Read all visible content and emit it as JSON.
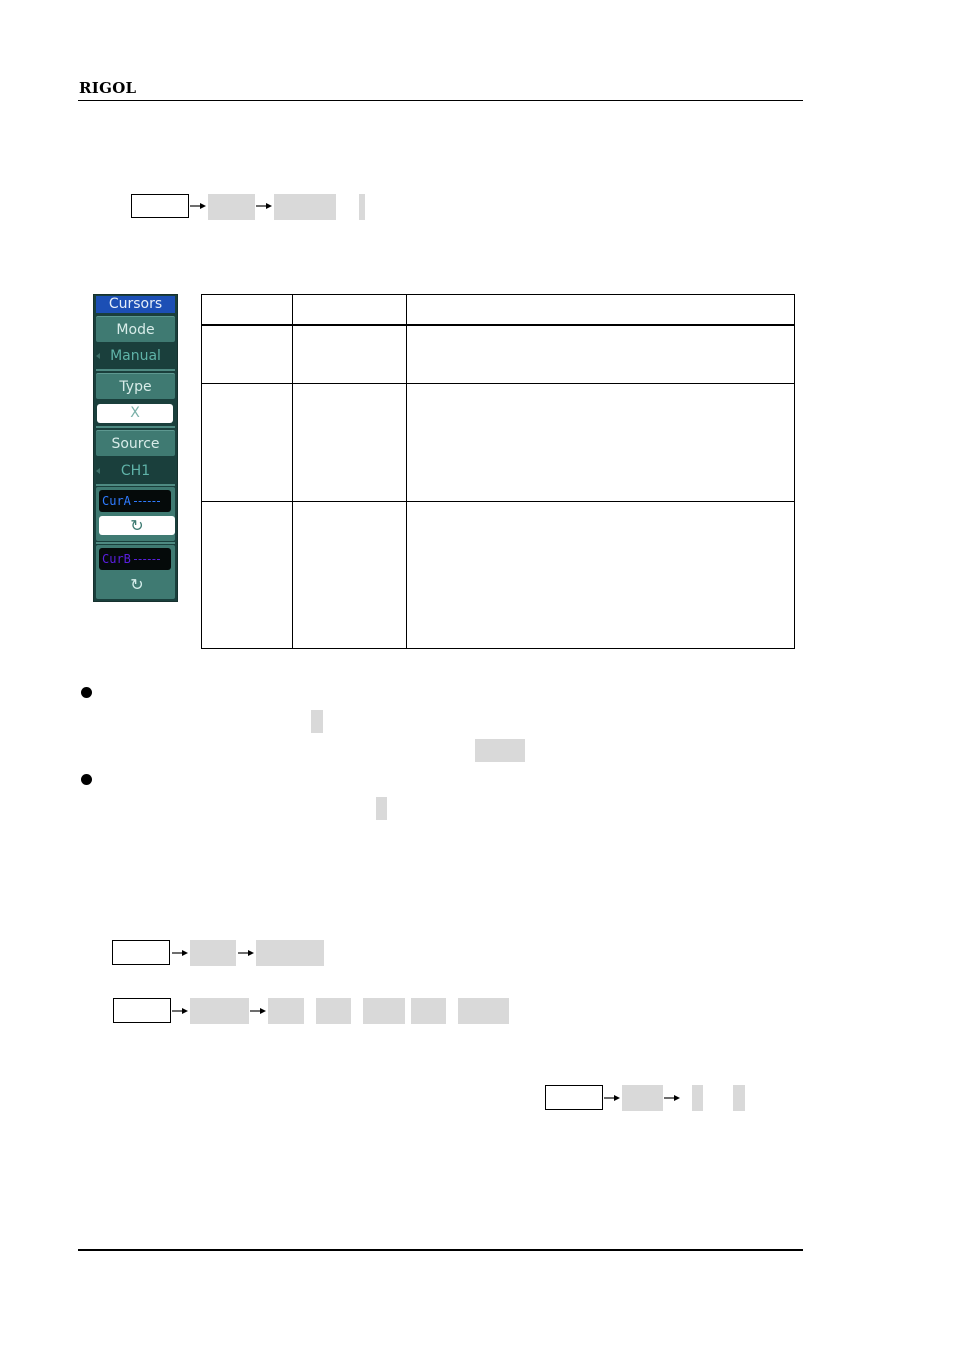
{
  "header": {
    "brand": "RIGOL"
  },
  "menu": {
    "title": "Cursors",
    "items": [
      {
        "label": "Mode",
        "value": "Manual",
        "value_style": "dark-with-arrow"
      },
      {
        "label": "Type",
        "value": "X",
        "value_style": "highlighted"
      },
      {
        "label": "Source",
        "value": "CH1",
        "value_style": "dark-with-arrow"
      }
    ],
    "cursor_a": {
      "label": "CurA",
      "color": "#2f7bff",
      "knob_icon": "rotate-knob-icon",
      "selected": true
    },
    "cursor_b": {
      "label": "CurB",
      "color": "#5a1fe0",
      "knob_icon": "rotate-knob-icon",
      "selected": false
    },
    "knob_glyph": "↻"
  },
  "table": {
    "headers": [
      "",
      "",
      ""
    ],
    "rows": [
      [
        "",
        "",
        ""
      ],
      [
        "",
        "",
        ""
      ],
      [
        "",
        "",
        ""
      ]
    ]
  },
  "key_sequences": [
    {
      "front_key": "",
      "soft_keys": [
        "",
        ""
      ],
      "extra": [
        ""
      ]
    },
    {
      "front_key": "",
      "soft_keys": [
        "",
        ""
      ],
      "extra": []
    },
    {
      "front_key": "",
      "soft_keys": [
        "",
        "",
        "",
        "",
        "",
        ""
      ],
      "extra": []
    },
    {
      "front_key": "",
      "soft_keys": [
        "",
        ""
      ],
      "extra": [
        ""
      ]
    }
  ],
  "bullets": [
    "",
    ""
  ],
  "colors": {
    "menu_bg": "#1a3f3c",
    "menu_button": "#3f7a72",
    "menu_title": "#1c4fb5",
    "placeholder_gray": "#d9d9d9"
  }
}
